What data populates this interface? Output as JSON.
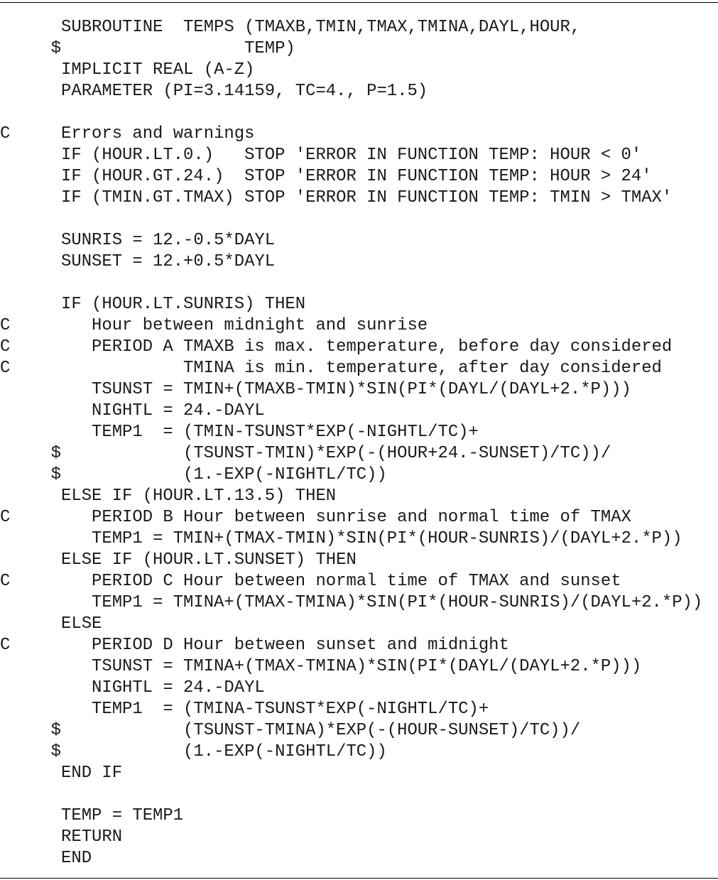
{
  "document": {
    "lines": [
      "      SUBROUTINE  TEMPS (TMAXB,TMIN,TMAX,TMINA,DAYL,HOUR,",
      "     $                  TEMP)",
      "      IMPLICIT REAL (A-Z)",
      "      PARAMETER (PI=3.14159, TC=4., P=1.5)",
      "",
      "C     Errors and warnings",
      "      IF (HOUR.LT.0.)   STOP 'ERROR IN FUNCTION TEMP: HOUR < 0'",
      "      IF (HOUR.GT.24.)  STOP 'ERROR IN FUNCTION TEMP: HOUR > 24'",
      "      IF (TMIN.GT.TMAX) STOP 'ERROR IN FUNCTION TEMP: TMIN > TMAX'",
      "",
      "      SUNRIS = 12.-0.5*DAYL",
      "      SUNSET = 12.+0.5*DAYL",
      "",
      "      IF (HOUR.LT.SUNRIS) THEN",
      "C        Hour between midnight and sunrise",
      "C        PERIOD A TMAXB is max. temperature, before day considered",
      "C                 TMINA is min. temperature, after day considered",
      "         TSUNST = TMIN+(TMAXB-TMIN)*SIN(PI*(DAYL/(DAYL+2.*P)))",
      "         NIGHTL = 24.-DAYL",
      "         TEMP1  = (TMIN-TSUNST*EXP(-NIGHTL/TC)+",
      "     $            (TSUNST-TMIN)*EXP(-(HOUR+24.-SUNSET)/TC))/",
      "     $            (1.-EXP(-NIGHTL/TC))",
      "      ELSE IF (HOUR.LT.13.5) THEN",
      "C        PERIOD B Hour between sunrise and normal time of TMAX",
      "         TEMP1 = TMIN+(TMAX-TMIN)*SIN(PI*(HOUR-SUNRIS)/(DAYL+2.*P))",
      "      ELSE IF (HOUR.LT.SUNSET) THEN",
      "C        PERIOD C Hour between normal time of TMAX and sunset",
      "         TEMP1 = TMINA+(TMAX-TMINA)*SIN(PI*(HOUR-SUNRIS)/(DAYL+2.*P))",
      "      ELSE",
      "C        PERIOD D Hour between sunset and midnight",
      "         TSUNST = TMINA+(TMAX-TMINA)*SIN(PI*(DAYL/(DAYL+2.*P)))",
      "         NIGHTL = 24.-DAYL",
      "         TEMP1  = (TMINA-TSUNST*EXP(-NIGHTL/TC)+",
      "     $            (TSUNST-TMINA)*EXP(-(HOUR-SUNSET)/TC))/",
      "     $            (1.-EXP(-NIGHTL/TC))",
      "      END IF",
      "",
      "      TEMP = TEMP1",
      "      RETURN",
      "      END"
    ]
  }
}
